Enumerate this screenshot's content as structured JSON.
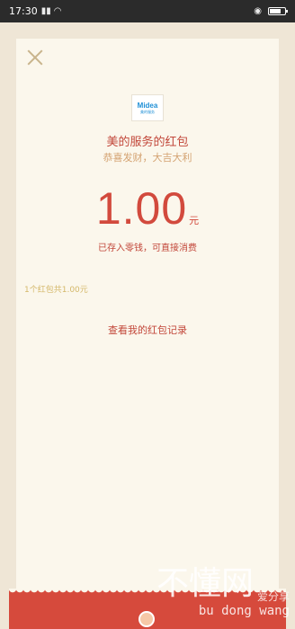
{
  "status_bar": {
    "time": "17:30"
  },
  "card": {
    "logo_text": "Midea",
    "logo_subtext": "美的服务",
    "sender": "美的服务的红包",
    "greeting": "恭喜发财，大吉大利",
    "amount": "1.00",
    "unit": "元",
    "deposit_note": "已存入零钱，可直接消费",
    "summary": "1个红包共1.00元",
    "records_link": "查看我的红包记录"
  },
  "watermark": {
    "main": "不懂网",
    "side": "爱分享",
    "sub": "bu dong wang"
  },
  "colors": {
    "accent_red": "#d24a3d",
    "card_bg": "#fbf7ec",
    "page_bg": "#efe6d6",
    "gold": "#d4b86a"
  }
}
